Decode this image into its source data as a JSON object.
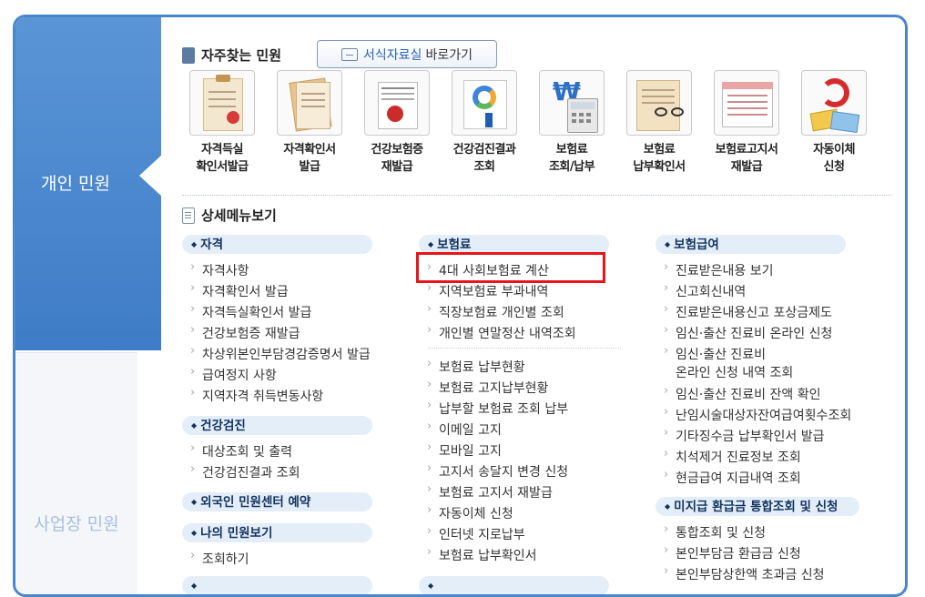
{
  "side_tabs": {
    "personal": "개인 민원",
    "business": "사업장 민원"
  },
  "frequent": {
    "title": "자주찾는 민원",
    "forms_button": {
      "highlight": "서식자료실",
      "rest": "바로가기"
    },
    "items": [
      {
        "line1": "자격득실",
        "line2": "확인서발급",
        "icon": "clipboard-icon"
      },
      {
        "line1": "자격확인서",
        "line2": "발급",
        "icon": "document-icon"
      },
      {
        "line1": "건강보험증",
        "line2": "재발급",
        "icon": "insurance-card-icon"
      },
      {
        "line1": "건강검진결과",
        "line2": "조회",
        "icon": "chart-report-icon"
      },
      {
        "line1": "보험료",
        "line2": "조회/납부",
        "icon": "calculator-icon"
      },
      {
        "line1": "보험료",
        "line2": "납부확인서",
        "icon": "glasses-document-icon"
      },
      {
        "line1": "보험료고지서",
        "line2": "재발급",
        "icon": "bill-icon"
      },
      {
        "line1": "자동이체",
        "line2": "신청",
        "icon": "auto-transfer-icon"
      }
    ]
  },
  "detail": {
    "title": "상세메뉴보기",
    "col1": {
      "categories": {
        "qualification": "자격",
        "checkup": "건강검진",
        "foreigner": "외국인 민원센터 예약",
        "my": "나의 민원보기"
      },
      "qualification_items": [
        "자격사항",
        "자격확인서 발급",
        "자격득실확인서 발급",
        "건강보험증 재발급",
        "차상위본인부담경감증명서 발급",
        "급여정지 사항",
        "지역자격 취득변동사항"
      ],
      "checkup_items": [
        "대상조회 및 출력",
        "건강검진결과 조회"
      ],
      "my_items": [
        "조회하기"
      ]
    },
    "col2": {
      "category": "보험료",
      "items_a": [
        "4대 사회보험료 계산",
        "지역보험료 부과내역",
        "직장보험료 개인별 조회",
        "개인별 연말정산 내역조회"
      ],
      "items_b": [
        "보험료 납부현황",
        "보험료 고지납부현황",
        "납부할 보험료 조회 납부",
        "이메일 고지",
        "모바일 고지",
        "고지서 송달지 변경 신청",
        "보험료 고지서 재발급",
        "자동이체 신청",
        "인터넷 지로납부",
        "보험료 납부확인서"
      ]
    },
    "col3": {
      "category": "보험급여",
      "items": [
        "진료받은내용 보기",
        "신고회신내역",
        "진료받은내용신고 포상금제도",
        "임신·출산 진료비 온라인 신청"
      ],
      "item_multi_line1": "임신·출산 진료비",
      "item_multi_line2": "온라인 신청 내역 조회",
      "items_after": [
        "임신·출산 진료비 잔액 확인",
        "난임시술대상자잔여급여횟수조회",
        "기타징수금 납부확인서 발급",
        "치석제거 진료정보 조회",
        "현금급여 지급내역 조회"
      ],
      "category2": "미지급 환급금 통합조회 및 신청",
      "items2": [
        "통합조회 및 신청",
        "본인부담금 환급금 신청",
        "본인부담상한액 초과금 신청"
      ]
    }
  },
  "colors": {
    "accent": "#4a86cc",
    "highlight_box": "#e8141c",
    "category_bg": "#e4eef9"
  }
}
